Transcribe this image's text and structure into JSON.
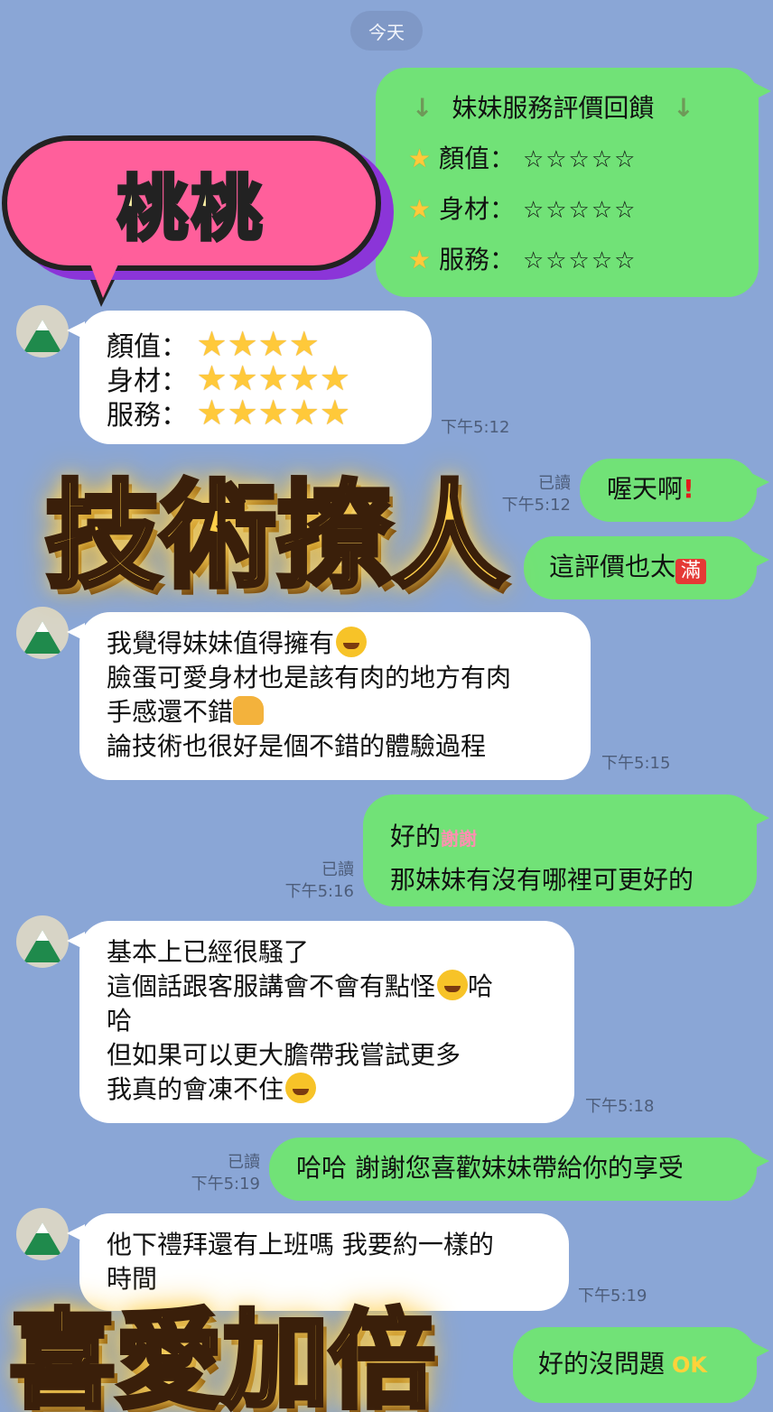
{
  "date": "今天",
  "rating_card": {
    "title": "妹妹服務評價回饋",
    "rows": [
      {
        "label": "顏值：",
        "stars": "☆☆☆☆☆"
      },
      {
        "label": "身材：",
        "stars": "☆☆☆☆☆"
      },
      {
        "label": "服務：",
        "stars": "☆☆☆☆☆"
      }
    ]
  },
  "reply_ratings": {
    "rows": [
      {
        "label": "顏值：",
        "stars": "★★★★"
      },
      {
        "label": "身材：",
        "stars": "★★★★★"
      },
      {
        "label": "服務：",
        "stars": "★★★★★"
      }
    ],
    "time": "下午5:12"
  },
  "msgs": {
    "m1_text": "喔天啊",
    "m1_read": "已讀",
    "m1_time": "下午5:12",
    "m2_text": "這評價也太",
    "m3_lines": [
      "我覺得妹妹值得擁有",
      "臉蛋可愛身材也是該有肉的地方有肉",
      "手感還不錯",
      "論技術也很好是個不錯的體驗過程"
    ],
    "m3_time": "下午5:15",
    "m4_line1": "好的",
    "m4_line2": "那妹妹有沒有哪裡可更好的",
    "m4_read": "已讀",
    "m4_time": "下午5:16",
    "m5_lines": [
      "基本上已經很騷了",
      "這個話跟客服講會不會有點怪",
      "哈",
      "但如果可以更大膽帶我嘗試更多",
      "我真的會凍不住"
    ],
    "m5_time": "下午5:18",
    "m6_text": "哈哈 謝謝您喜歡妹妹帶給你的享受",
    "m6_read": "已讀",
    "m6_time": "下午5:19",
    "m7_lines": [
      "他下禮拜還有上班嗎 我要約一樣的",
      "時間"
    ],
    "m7_time": "下午5:19",
    "m8_text": "好的沒問題"
  },
  "emoji": {
    "man": "滿",
    "xie": "謝謝",
    "ok": "OK",
    "end_ha": "哈"
  },
  "overlays": {
    "speech": "桃桃",
    "title1": "技術撩人",
    "title2": "喜愛加倍"
  }
}
